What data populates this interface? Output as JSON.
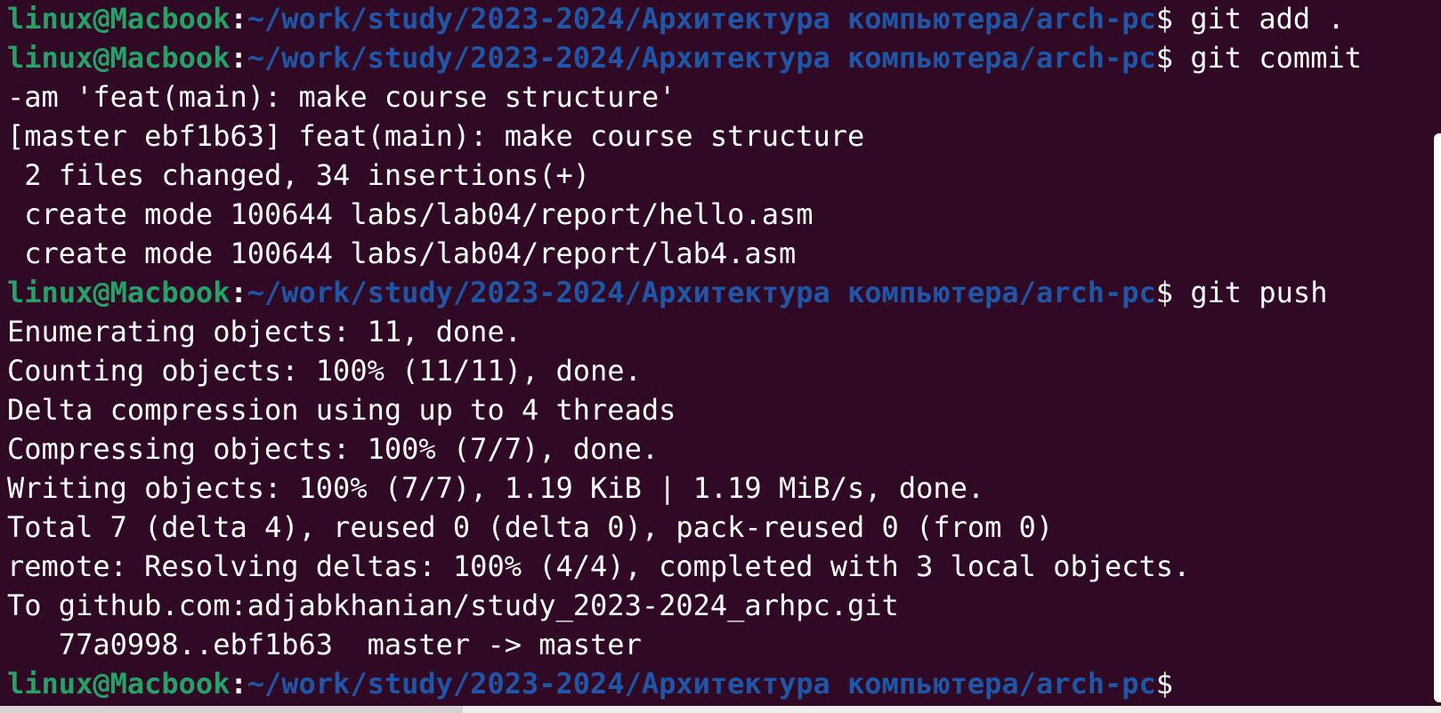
{
  "prompt": {
    "user": "linux@Macbook",
    "colon": ":",
    "path": "~/work/study/2023-2024/Архитектура компьютера/arch-pc",
    "sign": "$"
  },
  "lines": [
    {
      "type": "prompt",
      "command": " git add ."
    },
    {
      "type": "prompt",
      "command": " git commit"
    },
    {
      "type": "output",
      "text": "-am 'feat(main): make course structure'"
    },
    {
      "type": "output",
      "text": "[master ebf1b63] feat(main): make course structure"
    },
    {
      "type": "output",
      "text": " 2 files changed, 34 insertions(+)"
    },
    {
      "type": "output",
      "text": " create mode 100644 labs/lab04/report/hello.asm"
    },
    {
      "type": "output",
      "text": " create mode 100644 labs/lab04/report/lab4.asm"
    },
    {
      "type": "prompt",
      "command": " git push"
    },
    {
      "type": "output",
      "text": "Enumerating objects: 11, done."
    },
    {
      "type": "output",
      "text": "Counting objects: 100% (11/11), done."
    },
    {
      "type": "output",
      "text": "Delta compression using up to 4 threads"
    },
    {
      "type": "output",
      "text": "Compressing objects: 100% (7/7), done."
    },
    {
      "type": "output",
      "text": "Writing objects: 100% (7/7), 1.19 KiB | 1.19 MiB/s, done."
    },
    {
      "type": "output",
      "text": "Total 7 (delta 4), reused 0 (delta 0), pack-reused 0 (from 0)"
    },
    {
      "type": "output",
      "text": "remote: Resolving deltas: 100% (4/4), completed with 3 local objects."
    },
    {
      "type": "output",
      "text": "To github.com:adjabkhanian/study_2023-2024_arhpc.git"
    },
    {
      "type": "output",
      "text": "   77a0998..ebf1b63  master -> master"
    },
    {
      "type": "prompt",
      "command": ""
    }
  ],
  "colors": {
    "background": "#300a24",
    "user": "#26a269",
    "path": "#1f56a8",
    "text": "#ffffff"
  }
}
